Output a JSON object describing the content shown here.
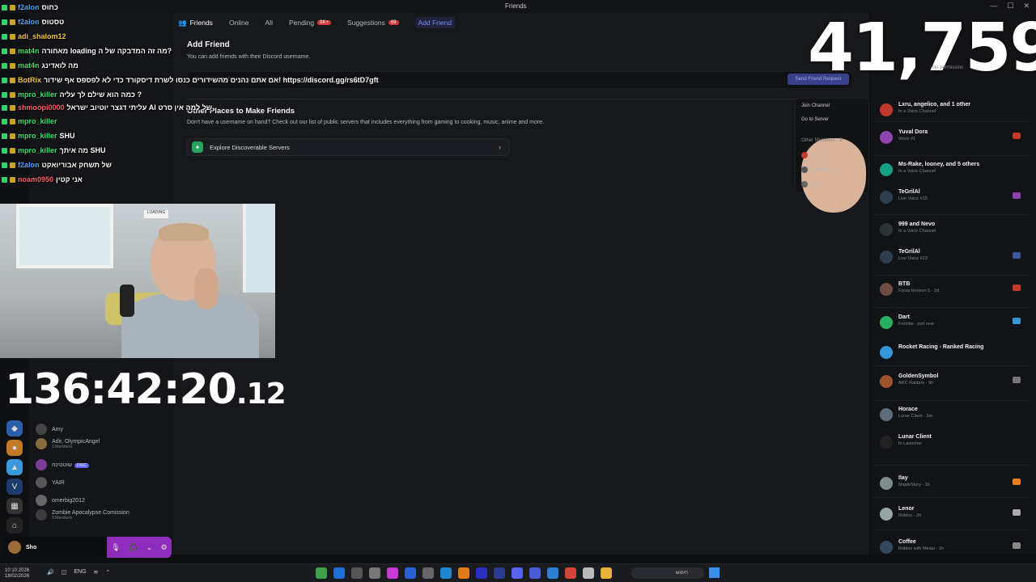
{
  "window": {
    "title": "Friends"
  },
  "tabs": [
    {
      "label": "Friends",
      "badge": ""
    },
    {
      "label": "Online",
      "badge": ""
    },
    {
      "label": "All",
      "badge": ""
    },
    {
      "label": "Pending",
      "badge": "9K+"
    },
    {
      "label": "Suggestions",
      "badge": "69"
    },
    {
      "label": "Add Friend",
      "badge": ""
    }
  ],
  "add_friend": {
    "title": "Add Friend",
    "subtitle": "You can add friends with their Discord username.",
    "placeholder": "You can add friends with their Discord username.",
    "send_label": "Send Friend Request"
  },
  "other_places": {
    "title": "Other Places to Make Friends",
    "subtitle": "Don't have a username on hand? Check out our list of public servers that includes everything from gaming to cooking, music, anime and more.",
    "explore_label": "Explore Discoverable Servers"
  },
  "context_menu": {
    "join": "Join Channel",
    "goto": "Go to Server",
    "members_header": "Other Members - 3",
    "members": [
      "Lxru",
      "angelico",
      "Echo"
    ]
  },
  "overlay": {
    "counter": "41,759",
    "no_permission": "No permission",
    "timer_main": "136:42:20",
    "timer_frac": ".12",
    "webcam_sign": "LOADING"
  },
  "chat": [
    {
      "user": "f2alon",
      "text": "כחוס",
      "color": ""
    },
    {
      "user": "f2alon",
      "text": "טסטוס",
      "color": ""
    },
    {
      "user": "adi_shalom12",
      "text": "",
      "color": "y"
    },
    {
      "user": "mat4n",
      "text": "מאחורה loading מה זה המדבקה של ה?",
      "color": "g"
    },
    {
      "user": "mat4n",
      "text": "מה לואדינג",
      "color": "g"
    },
    {
      "user": "BotRix",
      "text": "אם אתם נהנים מהשידורים כנסו לשרת דיסקורד כדי לא לפספס אף שידור! https://discord.gg/rs6tD7gft",
      "color": "y"
    },
    {
      "user": "mpro_killer",
      "text": "כמה הוא שילם לך עליה ?",
      "color": "g"
    },
    {
      "user": "shmoopi0000",
      "text": "עליתי דגצר יוטיוב ישראל AI של למה אין סרט",
      "color": "r"
    },
    {
      "user": "mpro_killer",
      "text": "",
      "color": "g"
    },
    {
      "user": "mpro_killer",
      "text": "SHU",
      "color": "g"
    },
    {
      "user": "mpro_killer",
      "text": "מה איתך SHU",
      "color": "g"
    },
    {
      "user": "f2alon",
      "text": "של תשחק אבוריואקט",
      "color": ""
    },
    {
      "user": "noam0950",
      "text": "אני קטין",
      "color": "r"
    }
  ],
  "dm_list": [
    {
      "name": "Amy",
      "sub": "",
      "chip": ""
    },
    {
      "name": "Adir, OlympicAngel",
      "sub": "3 Members",
      "chip": ""
    },
    {
      "name": "שוטטינה",
      "sub": "",
      "chip": "DISC"
    },
    {
      "name": "YAIR",
      "sub": "",
      "chip": ""
    },
    {
      "name": "omerbig2012",
      "sub": "",
      "chip": ""
    },
    {
      "name": "Zombie Apocalypse Comission",
      "sub": "3 Members",
      "chip": ""
    }
  ],
  "user_panel": {
    "name": "Sho",
    "sub": ""
  },
  "activity": [
    {
      "name": "Lxru, angelico, and 1 other",
      "sub": "In a Voice Channel",
      "color": "#c0392b"
    },
    {
      "name": "Yuval Dora",
      "sub": "Voice #1",
      "color": "#8e44ad"
    },
    {
      "name": "Ms-Rake, looney, and 5 others",
      "sub": "In a Voice Channel",
      "color": "#16a085"
    },
    {
      "name": "TeGrilAl",
      "sub": "Live Voice #15",
      "color": "#2c3e50"
    },
    {
      "name": "999 and Nevo",
      "sub": "In a Voice Channel",
      "color": "#2d3436"
    },
    {
      "name": "TeGrilAl",
      "sub": "Live Voice #23",
      "color": "#2c3e50"
    },
    {
      "name": "BTB",
      "sub": "Forza Horizon 5 - 2d",
      "color": "#6d4c41"
    },
    {
      "name": "Dart",
      "sub": "Fortnite - just now",
      "color": "#27ae60"
    },
    {
      "name": "Rocket Racing - Ranked Racing",
      "sub": "",
      "color": "#3498db"
    },
    {
      "name": "GoldenSymbol",
      "sub": "ARC Raiders - 9h",
      "color": "#a0522d"
    },
    {
      "name": "Horace",
      "sub": "Lunar Client - 9m",
      "color": "#5d6d7e"
    },
    {
      "name": "Lunar Client",
      "sub": "In Launcher",
      "color": "#222"
    },
    {
      "name": "Ilay",
      "sub": "MapleStory - 1h",
      "color": "#7f8c8d"
    },
    {
      "name": "Lenor",
      "sub": "Roblox - 2h",
      "color": "#95a5a6"
    },
    {
      "name": "Coffee",
      "sub": "Roblox with Medal - 1h",
      "color": "#34495e"
    }
  ],
  "taskbar": {
    "time": "10:10:2026",
    "date": "18/02/2026",
    "lang": "ENG",
    "search_text": "חיפוש"
  }
}
